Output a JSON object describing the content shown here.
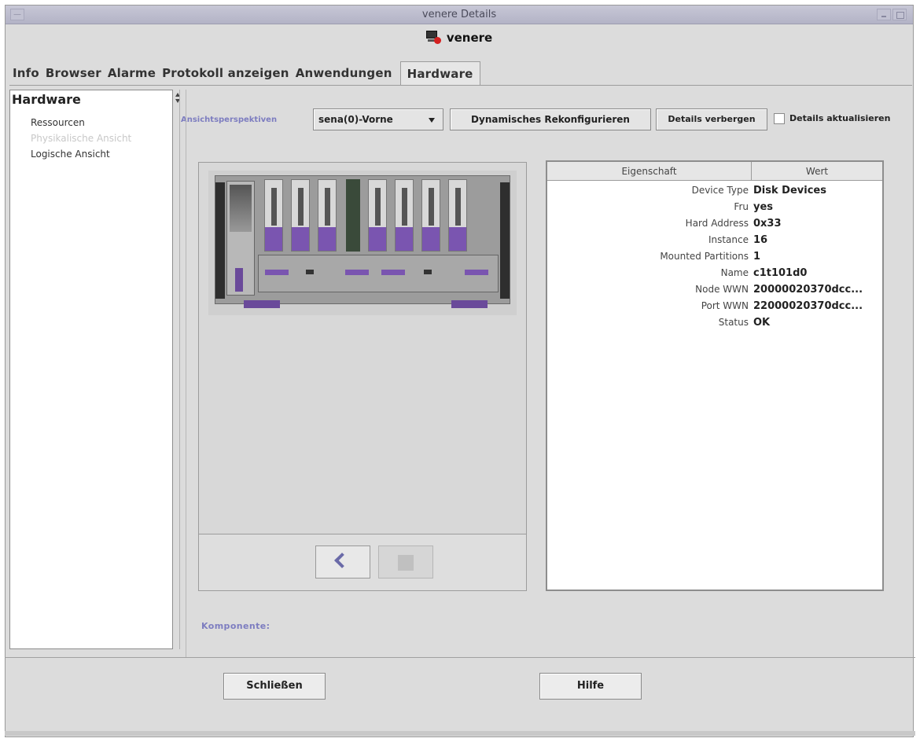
{
  "window": {
    "title": "venere Details",
    "host": "venere"
  },
  "tabs": [
    {
      "label": "Info"
    },
    {
      "label": "Browser"
    },
    {
      "label": "Alarme"
    },
    {
      "label": "Protokoll anzeigen"
    },
    {
      "label": "Anwendungen"
    },
    {
      "label": "Hardware",
      "active": true
    }
  ],
  "tree": {
    "root": "Hardware",
    "items": [
      {
        "label": "Ressourcen",
        "disabled": false
      },
      {
        "label": "Physikalische Ansicht",
        "disabled": true
      },
      {
        "label": "Logische Ansicht",
        "disabled": false
      }
    ]
  },
  "controls": {
    "perspective_label": "Ansichtsperspektiven",
    "perspective_value": "sena(0)-Vorne",
    "dynamic_reconfigure": "Dynamisches Rekonfigurieren",
    "hide_details": "Details verbergen",
    "refresh_details_label": "Details aktualisieren",
    "refresh_details_checked": false
  },
  "properties": {
    "headers": {
      "property": "Eigenschaft",
      "value": "Wert"
    },
    "rows": [
      {
        "key": "Device Type",
        "value": "Disk Devices"
      },
      {
        "key": "Fru",
        "value": "yes"
      },
      {
        "key": "Hard Address",
        "value": "0x33"
      },
      {
        "key": "Instance",
        "value": "16"
      },
      {
        "key": "Mounted Partitions",
        "value": "1"
      },
      {
        "key": "Name",
        "value": "c1t101d0"
      },
      {
        "key": "Node WWN",
        "value": "20000020370dcc..."
      },
      {
        "key": "Port WWN",
        "value": "22000020370dcc..."
      },
      {
        "key": "Status",
        "value": "OK"
      }
    ]
  },
  "component_label": "Komponente:",
  "footer": {
    "close": "Schließen",
    "help": "Hilfe"
  },
  "colors": {
    "accent_label": "#7d7dc0",
    "device_purple": "#7a55b0"
  }
}
